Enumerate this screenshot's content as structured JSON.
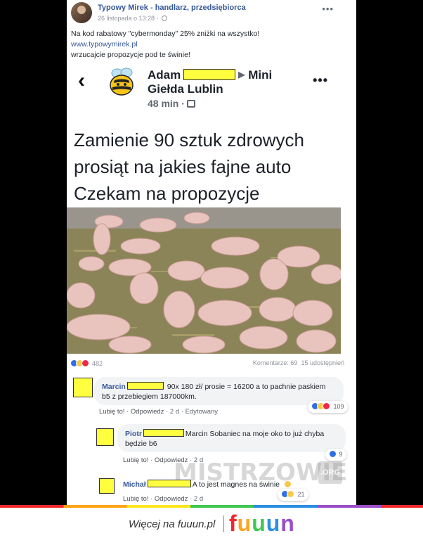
{
  "post": {
    "author": "Typowy Mirek - handlarz, przedsiębiorca",
    "date": "26 listopada o 13:28 ·",
    "line1": "Na kod rabatowy \"cybermonday\" 25% zniżki na wszystko!",
    "link": "www.typowymirek.pl",
    "line3": "wrzucajcie propozycje pod te świnie!",
    "menu": "•••"
  },
  "shared": {
    "back": "‹",
    "author_first": "Adam",
    "arrow": "▶",
    "group_part1": "Mini",
    "group_part2": "Giełda Lublin",
    "time": "48 min ·",
    "menu": "•••",
    "text_line1": "Zamienie 90 sztuk zdrowych",
    "text_line2": "prosiąt na jakies fajne auto",
    "text_line3": "Czekam na propozycje"
  },
  "stats": {
    "reactions_count": "482",
    "comments": "Komentarze: 69",
    "shares": "15 udostępnień"
  },
  "comments": [
    {
      "name": "Marcin",
      "text_a": "90x 180 zł/ prosie = 16200 a to pachnie paskiem",
      "text_b": "b5 z przebiegiem 187000km.",
      "like": "Lubię to!",
      "reply": "Odpowiedz",
      "time": "2 d",
      "edited": "Edytowany",
      "reactions": "109"
    },
    {
      "name": "Piotr",
      "text_a": "Marcin Sobaniec na moje oko to już chyba",
      "text_b": "będzie b6",
      "like": "Lubię to!",
      "reply": "Odpowiedz",
      "time": "2 d",
      "reactions": "9"
    },
    {
      "name": "Michał",
      "text_a": "A to jest magnes na świnie",
      "like": "Lubię to!",
      "reply": "Odpowiedz",
      "time": "2 d",
      "reactions": "21"
    }
  ],
  "watermark": {
    "text": "MISTRZOWIE",
    "tag": ".ORG"
  },
  "footer": {
    "more": "Więcej na fuuun.pl",
    "brand": [
      "f",
      "u",
      "u",
      "u",
      "n"
    ]
  },
  "colors": {
    "link": "#365899",
    "highlight": "#ffff40",
    "background": "#000000"
  }
}
